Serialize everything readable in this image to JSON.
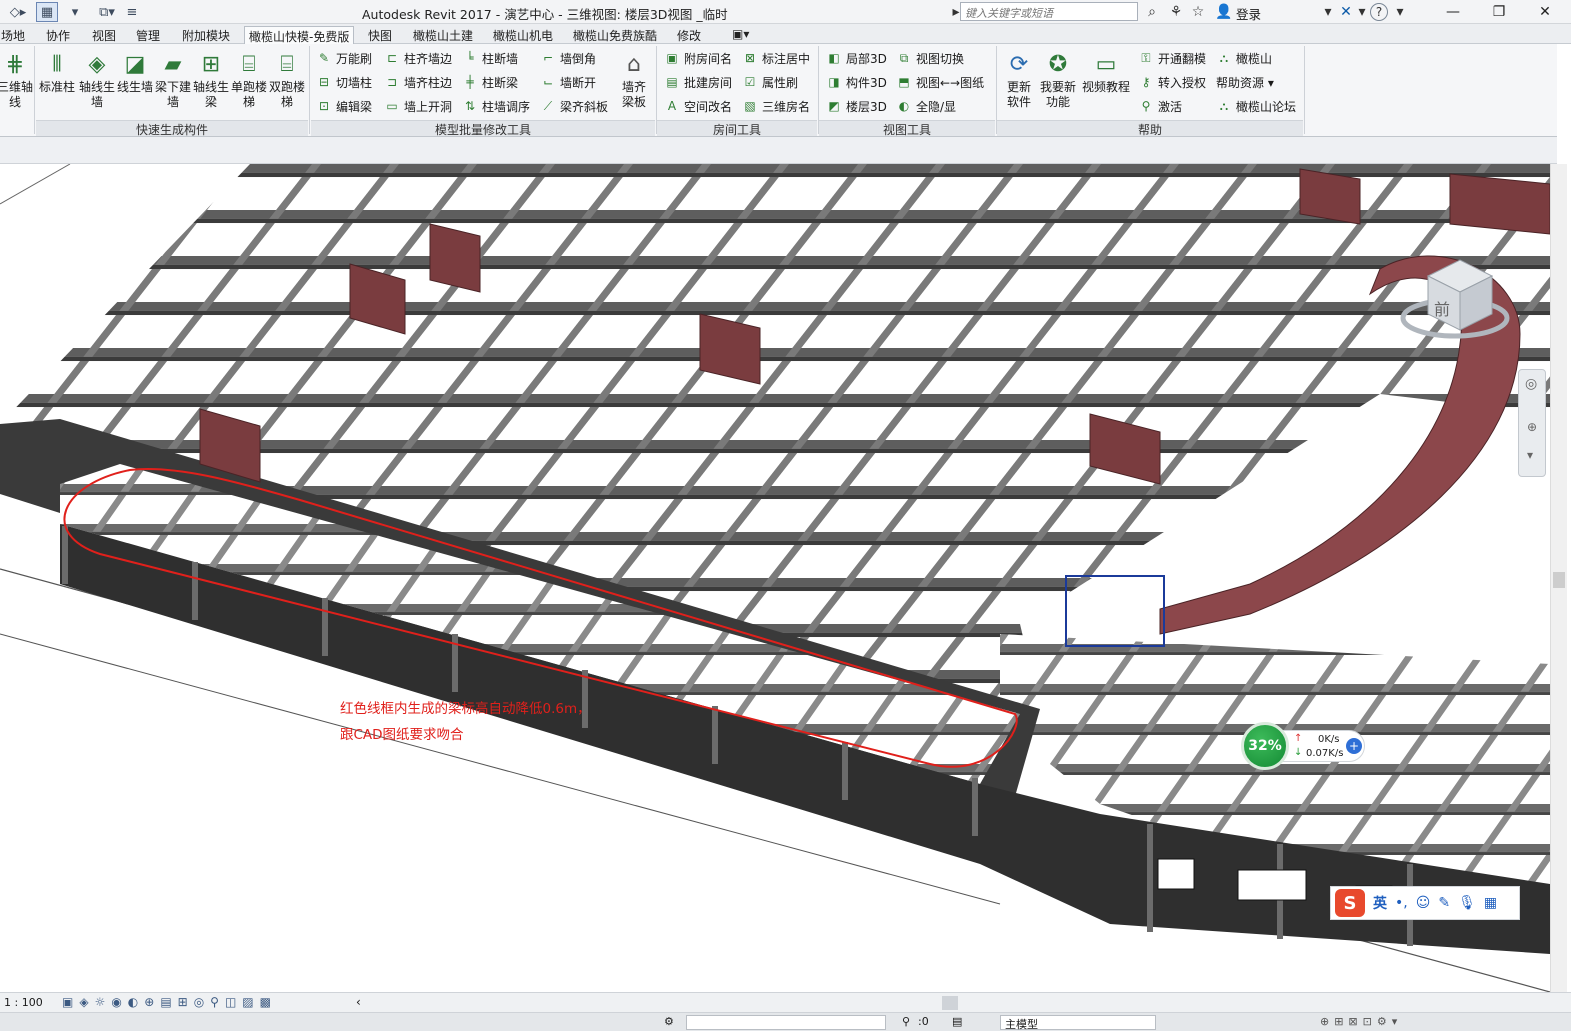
{
  "window": {
    "title": "Autodesk Revit 2017 -     演艺中心 - 三维视图: 楼层3D视图 _临时",
    "search_placeholder": "键入关键字或短语",
    "login_label": "登录",
    "minimize": "—",
    "maximize": "❐",
    "close": "✕"
  },
  "tabs": [
    "场地",
    "协作",
    "视图",
    "管理",
    "附加模块",
    "橄榄山快模-免费版",
    "快图",
    "橄榄山土建",
    "橄榄山机电",
    "橄榄山免费族酷",
    "修改",
    "▣▾"
  ],
  "active_tab": "橄榄山快模-免费版",
  "ribbon": {
    "panels": [
      {
        "title": "快速生成构件",
        "buttons": [
          "三维轴线",
          "标准柱",
          "轴线生墙",
          "线生墙",
          "梁下建墙",
          "轴线生梁",
          "单跑楼梯",
          "双跑楼梯"
        ]
      },
      {
        "title": "模型批量修改工具",
        "col1": [
          "万能刷",
          "切墙柱",
          "编辑梁"
        ],
        "col2": [
          "柱齐墙边",
          "墙齐柱边",
          "墙上开洞"
        ],
        "col3": [
          "柱断墙",
          "柱断梁",
          "柱墙调序"
        ],
        "col4": [
          "墙倒角",
          "墙断开",
          "梁齐斜板"
        ],
        "big": "墙齐梁板"
      },
      {
        "title": "房间工具",
        "col1": [
          "附房间名",
          "批建房间",
          "空间改名"
        ],
        "col2": [
          "标注居中",
          "属性刷",
          "三维房名"
        ]
      },
      {
        "title": "视图工具",
        "col1": [
          "局部3D",
          "构件3D",
          "楼层3D"
        ],
        "col2": [
          "视图切换",
          "视图←→图纸",
          "全隐/显"
        ]
      },
      {
        "title": "帮助",
        "big": [
          "更新软件",
          "我要新功能",
          "视频教程"
        ],
        "col1": [
          "开通翻模",
          "转入授权",
          "激活"
        ],
        "col2": [
          "橄榄山",
          "帮助资源 ▾",
          "橄榄山论坛"
        ]
      }
    ]
  },
  "annotation": {
    "line1": "红色线框内生成的梁标高自动降低0.6m，",
    "line2": "跟CAD图纸要求吻合"
  },
  "viewcube": {
    "face_label": "前"
  },
  "net_widget": {
    "percent": "32%",
    "up": "0K/s",
    "down": "0.07K/s"
  },
  "ime": {
    "lang": "英",
    "punct": "•,"
  },
  "viewbar": {
    "scale": "1 : 100"
  },
  "statusbar": {
    "mode": ":0",
    "model": "主模型"
  }
}
